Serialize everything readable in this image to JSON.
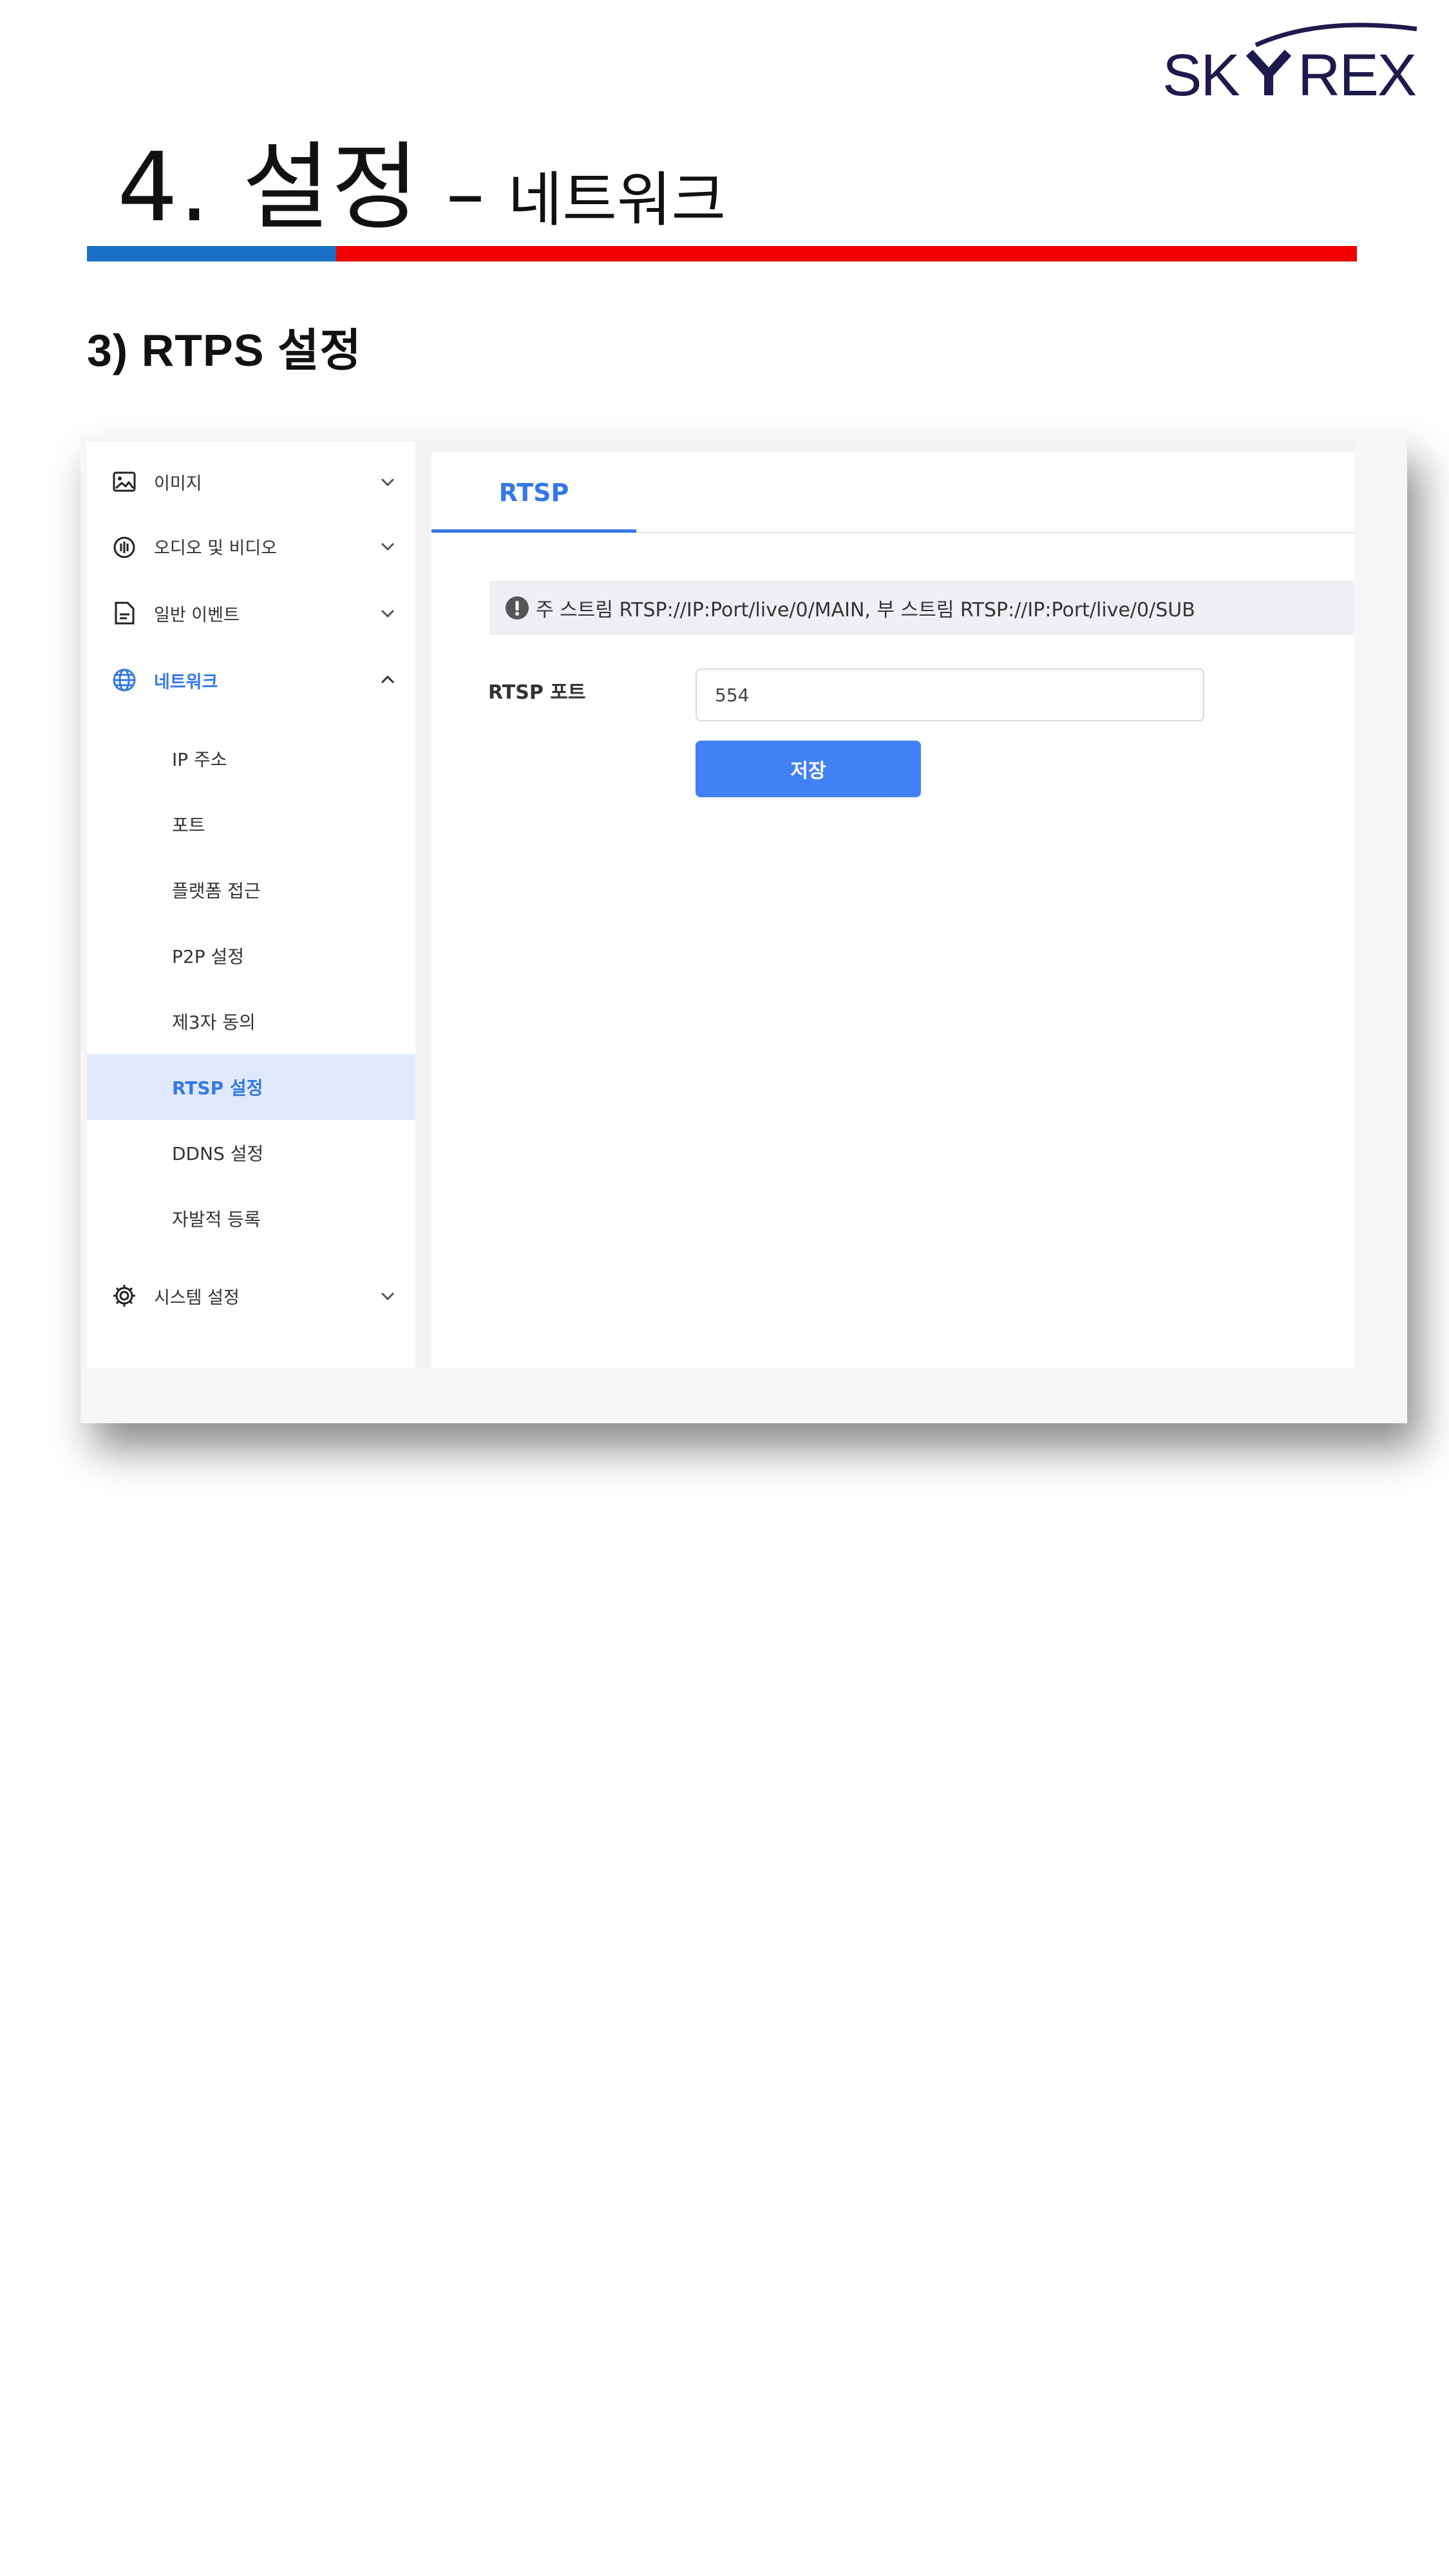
{
  "logo": {
    "text": "SKYREX"
  },
  "heading": {
    "main": "4. 설정",
    "dash": "–",
    "sub": "네트워크"
  },
  "section_title": "3) RTPS 설정",
  "sidebar": {
    "items": [
      {
        "label": "이미지",
        "icon": "image-icon"
      },
      {
        "label": "오디오 및 비디오",
        "icon": "audio-video-icon"
      },
      {
        "label": "일반 이벤트",
        "icon": "document-icon"
      },
      {
        "label": "네트워크",
        "icon": "globe-icon"
      },
      {
        "label": "시스템 설정",
        "icon": "gear-icon"
      }
    ],
    "network_subitems": [
      "IP 주소",
      "포트",
      "플랫폼 접근",
      "P2P 설정",
      "제3자 동의",
      "RTSP 설정",
      "DDNS 설정",
      "자발적 등록"
    ],
    "selected_subitem": "RTSP 설정"
  },
  "content": {
    "tab_label": "RTSP",
    "notice": "주 스트림 RTSP://IP:Port/live/0/MAIN, 부 스트림 RTSP://IP:Port/live/0/SUB",
    "rtsp_port_label": "RTSP 포트",
    "rtsp_port_value": "554",
    "save_label": "저장"
  },
  "colors": {
    "accent": "#3578e5",
    "button": "#4181f5",
    "bar_blue": "#1a6fc4",
    "bar_red": "#f20000",
    "logo": "#1e1a4d"
  }
}
